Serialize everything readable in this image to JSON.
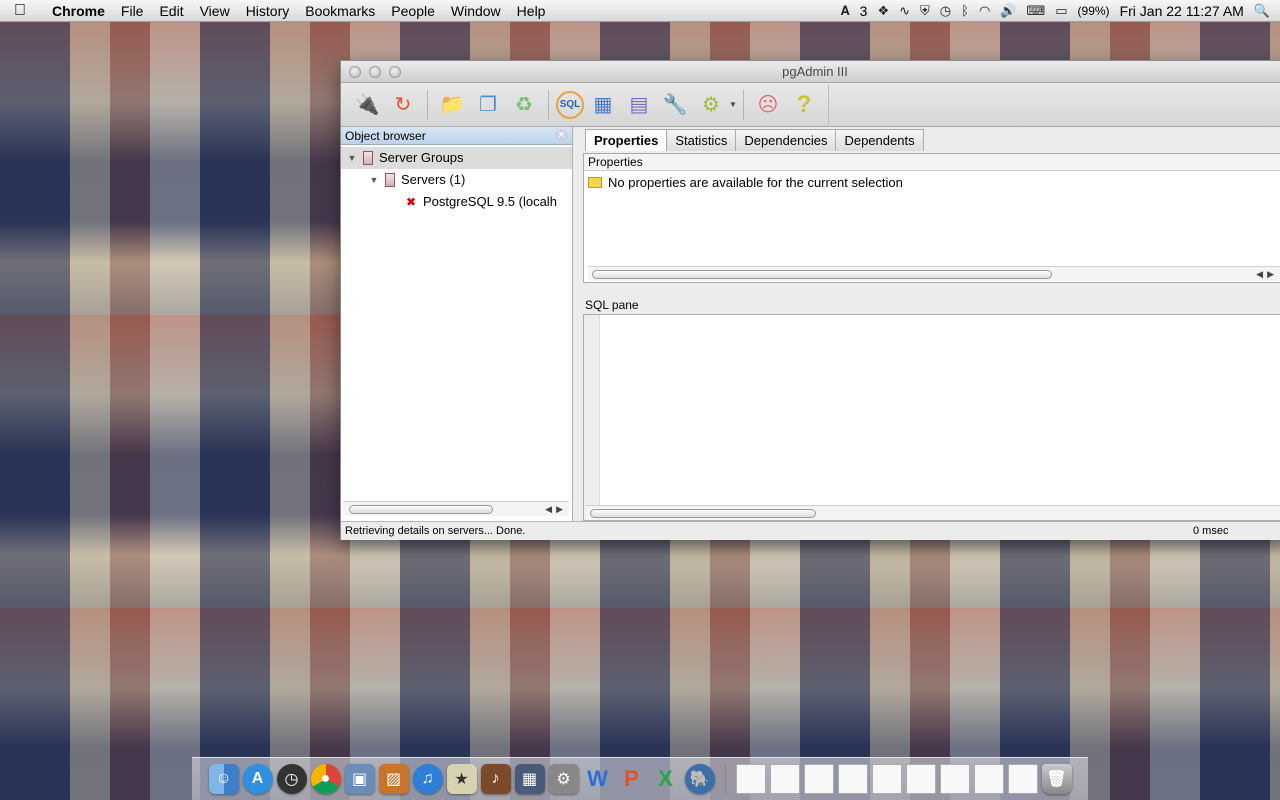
{
  "menubar": {
    "app_name": "Chrome",
    "items": [
      "File",
      "Edit",
      "View",
      "History",
      "Bookmarks",
      "People",
      "Window",
      "Help"
    ],
    "status": {
      "adobe_count": "3",
      "battery": "(99%)",
      "datetime": "Fri Jan 22  11:27 AM"
    }
  },
  "window": {
    "title": "pgAdmin III",
    "toolbar_icons": [
      "connect-icon",
      "refresh-icon",
      "properties-icon",
      "create-object-icon",
      "drop-object-icon",
      "sql-icon",
      "view-data-icon",
      "filtered-data-icon",
      "maintenance-icon",
      "plugins-icon",
      "hint-icon",
      "help-icon"
    ],
    "object_browser": {
      "title": "Object browser",
      "tree": {
        "root": "Server Groups",
        "servers": "Servers (1)",
        "server": "PostgreSQL 9.5 (localh"
      }
    },
    "tabs": [
      "Properties",
      "Statistics",
      "Dependencies",
      "Dependents"
    ],
    "properties": {
      "header": "Properties",
      "message": "No properties are available for the current selection"
    },
    "sql_pane": {
      "title": "SQL pane"
    },
    "statusbar": {
      "message": "Retrieving details on servers... Done.",
      "time": "0 msec"
    }
  },
  "dock": {
    "apps": [
      "finder-icon",
      "app-store-icon",
      "dashboard-icon",
      "chrome-icon",
      "preview-icon",
      "photos-icon",
      "itunes-icon",
      "xcode-icon",
      "garageband-icon",
      "launchpad-icon",
      "system-prefs-icon",
      "word-icon",
      "powerpoint-icon",
      "excel-icon",
      "pgadmin-icon"
    ]
  }
}
